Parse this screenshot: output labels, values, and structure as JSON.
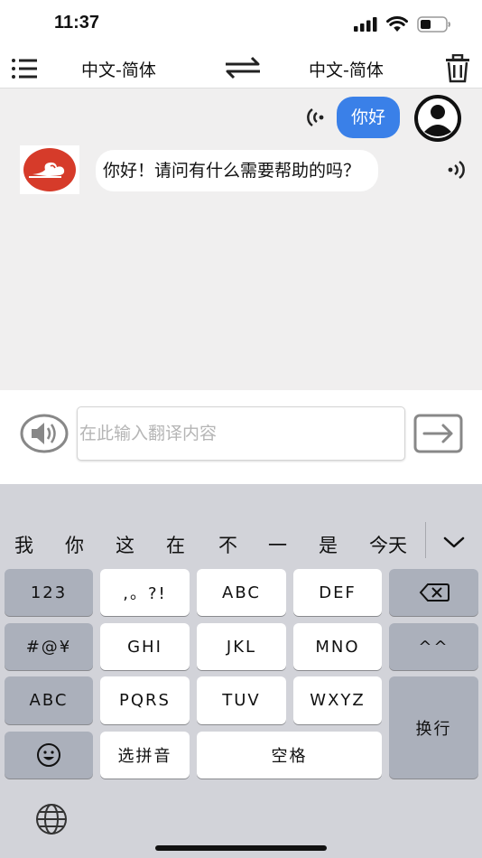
{
  "status": {
    "time": "11:37"
  },
  "nav": {
    "source_lang": "中文-简体",
    "target_lang": "中文-简体"
  },
  "chat": {
    "messages": [
      {
        "sender": "user",
        "text": "你好"
      },
      {
        "sender": "bot",
        "text": "你好！请问有什么需要帮助的吗？"
      }
    ]
  },
  "input": {
    "placeholder": "在此输入翻译内容",
    "value": ""
  },
  "keyboard": {
    "candidates": [
      "我",
      "你",
      "这",
      "在",
      "不",
      "一",
      "是",
      "今天"
    ],
    "keys": {
      "k123": "123",
      "punct": ",。?!",
      "abc_top": "ABC",
      "def": "DEF",
      "symbols": "#@¥",
      "ghi": "GHI",
      "jkl": "JKL",
      "mno": "MNO",
      "emoticon": "^^",
      "abc_left": "ABC",
      "pqrs": "PQRS",
      "tuv": "TUV",
      "wxyz": "WXYZ",
      "newline": "换行",
      "pinyin": "选拼音",
      "space": "空格"
    }
  },
  "colors": {
    "accent": "#3a80e8",
    "chat_bg": "#f0efef",
    "logo_red": "#d63b2a",
    "keyboard_bg": "#d2d3d9"
  }
}
